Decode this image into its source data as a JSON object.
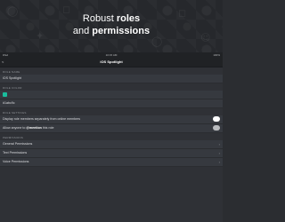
{
  "banner": {
    "line1": "Robust",
    "line1_bold": "roles",
    "line2": "and",
    "line2_bold": "permissions"
  },
  "status_bar": {
    "left": "iPad",
    "time": "10:15 AM",
    "right": "100%"
  },
  "nav": {
    "back_label": "<",
    "title": "iOS Spotlight"
  },
  "sections": {
    "role_name_header": "Role Name",
    "role_name_value": "iOS Spotlight",
    "color_header": "Role Color",
    "color_label": "#1abc9c",
    "role_settings_header": "Role Settings",
    "hoist_label": "Display role members separately from online members",
    "mention_prefix": "Allow anyone to",
    "mention_highlight": "@mention",
    "mention_suffix": "this role",
    "permissions_header": "Permissions",
    "general_permissions": "General Permissions",
    "text_permissions": "Text Permissions",
    "voice_permissions": "Voice Permissions"
  },
  "toggles": {
    "hoist_enabled": true,
    "mentionable_enabled": false
  },
  "colors": {
    "role_color": "#1abc9c",
    "background": "#2f3136"
  }
}
